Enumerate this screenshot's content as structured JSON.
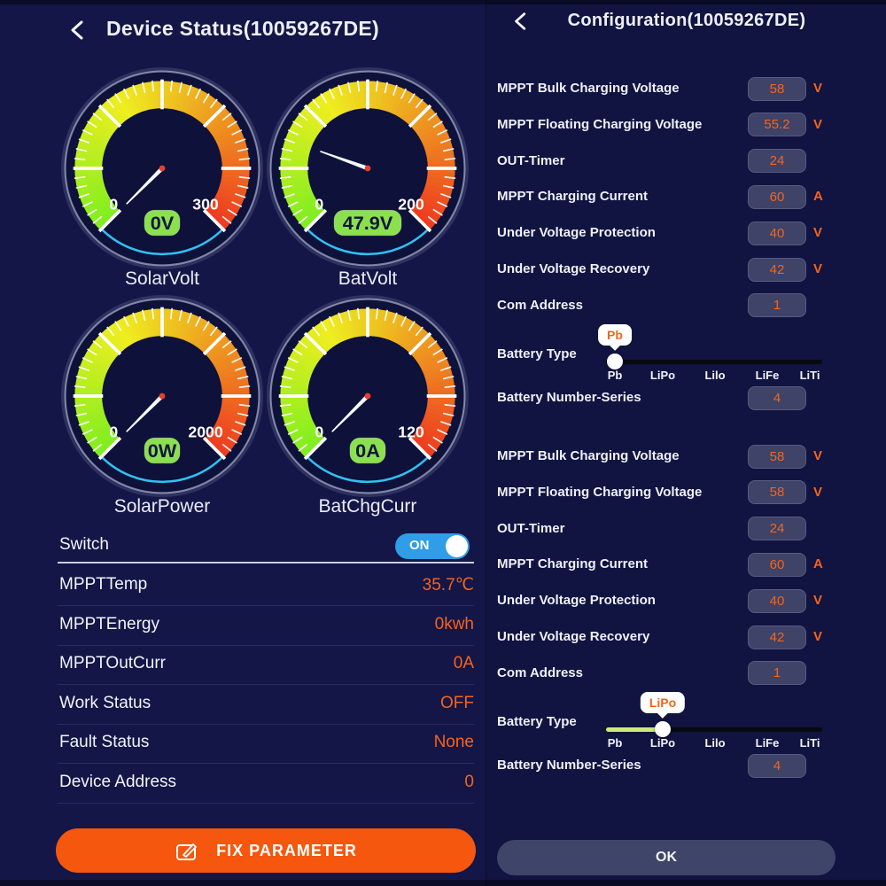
{
  "colors": {
    "accent_orange": "#F4641E",
    "button_orange": "#F4570D",
    "toggle_blue": "#2F9DE8",
    "badge_green": "#8BE04D",
    "slider_fill": "#CDE97B",
    "gauge_cyan": "#2EC2F6",
    "input_bg": "#3E4367",
    "ok_button_bg": "#3F4569",
    "panel_bg": "#131546"
  },
  "device_status": {
    "back_icon": "chevron-left",
    "title": "Device Status(10059267DE)",
    "gauges": [
      {
        "name": "SolarVolt",
        "min": "0",
        "max": "300",
        "value": "0V",
        "fraction": 0
      },
      {
        "name": "BatVolt",
        "min": "0",
        "max": "200",
        "value": "47.9V",
        "fraction": 0.2395
      },
      {
        "name": "SolarPower",
        "min": "0",
        "max": "2000",
        "value": "0W",
        "fraction": 0
      },
      {
        "name": "BatChgCurr",
        "min": "0",
        "max": "120",
        "value": "0A",
        "fraction": 0
      }
    ],
    "switch_row": {
      "label": "Switch",
      "state": "ON"
    },
    "rows": [
      {
        "label": "MPPTTemp",
        "value": "35.7℃"
      },
      {
        "label": "MPPTEnergy",
        "value": "0kwh"
      },
      {
        "label": "MPPTOutCurr",
        "value": "0A"
      },
      {
        "label": "Work Status",
        "value": "OFF"
      },
      {
        "label": "Fault Status",
        "value": "None"
      },
      {
        "label": "Device Address",
        "value": "0"
      }
    ],
    "fix_button": {
      "icon": "edit-icon",
      "label": "FIX PARAMETER"
    }
  },
  "configuration": {
    "back_icon": "chevron-left",
    "title": "Configuration(10059267DE)",
    "battery_options": [
      "Pb",
      "LiPo",
      "Lilo",
      "LiFe",
      "LiTi"
    ],
    "groups": [
      {
        "fields": [
          {
            "label": "MPPT Bulk Charging Voltage",
            "value": "58",
            "unit": "V"
          },
          {
            "label": "MPPT Floating Charging Voltage",
            "value": "55.2",
            "unit": "V"
          },
          {
            "label": "OUT-Timer",
            "value": "24",
            "unit": ""
          },
          {
            "label": "MPPT Charging Current",
            "value": "60",
            "unit": "A"
          },
          {
            "label": "Under Voltage Protection",
            "value": "40",
            "unit": "V"
          },
          {
            "label": "Under Voltage Recovery",
            "value": "42",
            "unit": "V"
          },
          {
            "label": "Com Address",
            "value": "1",
            "unit": ""
          }
        ],
        "battery_type": {
          "label": "Battery Type",
          "selected": "Pb",
          "selected_index": 0
        },
        "battery_series": {
          "label": "Battery Number-Series",
          "value": "4"
        }
      },
      {
        "fields": [
          {
            "label": "MPPT Bulk Charging Voltage",
            "value": "58",
            "unit": "V"
          },
          {
            "label": "MPPT Floating Charging Voltage",
            "value": "58",
            "unit": "V"
          },
          {
            "label": "OUT-Timer",
            "value": "24",
            "unit": ""
          },
          {
            "label": "MPPT Charging Current",
            "value": "60",
            "unit": "A"
          },
          {
            "label": "Under Voltage Protection",
            "value": "40",
            "unit": "V"
          },
          {
            "label": "Under Voltage Recovery",
            "value": "42",
            "unit": "V"
          },
          {
            "label": "Com Address",
            "value": "1",
            "unit": ""
          }
        ],
        "battery_type": {
          "label": "Battery Type",
          "selected": "LiPo",
          "selected_index": 1
        },
        "battery_series": {
          "label": "Battery Number-Series",
          "value": "4"
        }
      }
    ],
    "ok_button": "OK"
  }
}
